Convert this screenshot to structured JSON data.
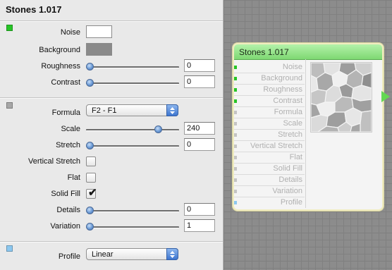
{
  "panel": {
    "title": "Stones 1.017",
    "groups": [
      {
        "color": "#27c427"
      },
      {
        "color": "#a7a7a7"
      },
      {
        "color": "#8cc8f0"
      }
    ],
    "noise": {
      "label": "Noise",
      "color": "#ffffff"
    },
    "background": {
      "label": "Background",
      "color": "#8a8a8a"
    },
    "roughness": {
      "label": "Roughness",
      "value": "0",
      "level": 0
    },
    "contrast": {
      "label": "Contrast",
      "value": "0",
      "level": 0
    },
    "formula": {
      "label": "Formula",
      "selected": "F2 - F1"
    },
    "scale": {
      "label": "Scale",
      "value": "240",
      "level": 0.8
    },
    "stretch": {
      "label": "Stretch",
      "value": "0",
      "level": 0
    },
    "vertical_stretch": {
      "label": "Vertical Stretch",
      "checked": false
    },
    "flat": {
      "label": "Flat",
      "checked": false
    },
    "solid_fill": {
      "label": "Solid Fill",
      "checked": true,
      "mark": "✔"
    },
    "details": {
      "label": "Details",
      "value": "0",
      "level": 0
    },
    "variation": {
      "label": "Variation",
      "value": "1",
      "level": 0
    },
    "profile": {
      "label": "Profile",
      "selected": "Linear"
    }
  },
  "node": {
    "title": "Stones 1.017",
    "header_color": "#7ed872",
    "inputs": [
      {
        "label": "Noise",
        "port_color": "#27c427"
      },
      {
        "label": "Background",
        "port_color": "#27c427"
      },
      {
        "label": "Roughness",
        "port_color": "#27c427"
      },
      {
        "label": "Contrast",
        "port_color": "#27c427"
      },
      {
        "label": "Formula",
        "port_color": "#c4c4c4"
      },
      {
        "label": "Scale",
        "port_color": "#c4c4c4"
      },
      {
        "label": "Stretch",
        "port_color": "#c4c4c4"
      },
      {
        "label": "Vertical Stretch",
        "port_color": "#c4c4c4"
      },
      {
        "label": "Flat",
        "port_color": "#c4c4c4"
      },
      {
        "label": "Solid Fill",
        "port_color": "#c4c4c4"
      },
      {
        "label": "Details",
        "port_color": "#c4c4c4"
      },
      {
        "label": "Variation",
        "port_color": "#c4c4c4"
      },
      {
        "label": "Profile",
        "port_color": "#8cc8f0"
      }
    ]
  }
}
